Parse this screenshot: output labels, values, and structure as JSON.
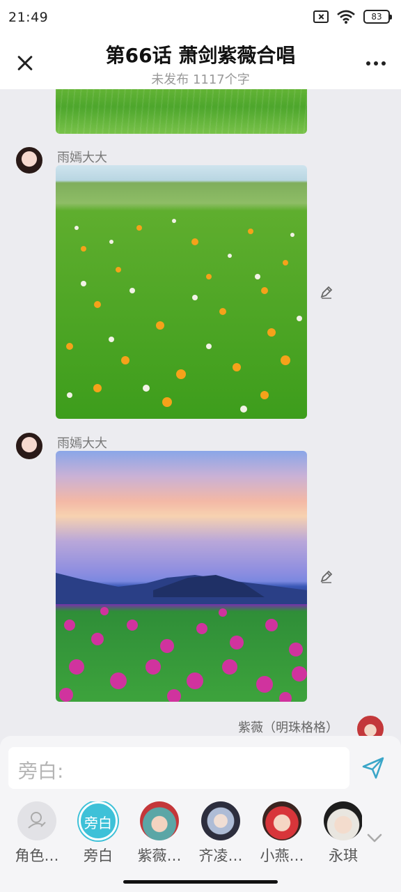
{
  "status_bar": {
    "time": "21:49",
    "battery": "83"
  },
  "header": {
    "title": "第66话 萧剑紫薇合唱",
    "subtitle": "未发布 1117个字"
  },
  "messages": [
    {
      "sender": "雨嫣大大"
    },
    {
      "sender": "雨嫣大大"
    },
    {
      "sender": "紫薇（明珠格格）"
    }
  ],
  "input": {
    "placeholder": "旁白:"
  },
  "roles": [
    {
      "label": "角色…"
    },
    {
      "label": "旁白",
      "avatar_text": "旁白"
    },
    {
      "label": "紫薇…"
    },
    {
      "label": "齐凌…"
    },
    {
      "label": "小燕…"
    },
    {
      "label": "永琪"
    }
  ],
  "colors": {
    "accent": "#3aa6c8",
    "narration_ring": "#3ec1d8"
  },
  "icons": [
    "close-icon",
    "more-icon",
    "edit-icon",
    "send-icon",
    "chevron-down-icon",
    "role-add-icon"
  ]
}
